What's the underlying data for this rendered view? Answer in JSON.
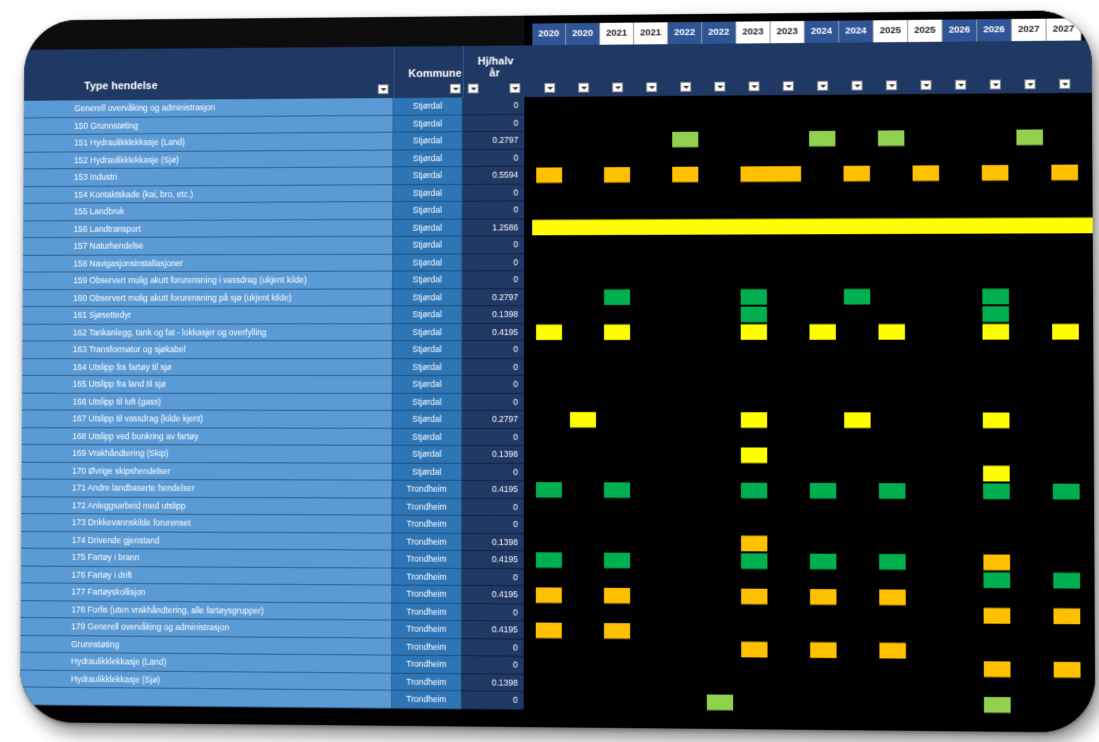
{
  "headers": {
    "type_hendelse": "Type hendelse",
    "kommune": "Kommune",
    "frequency": "Hj/halv år"
  },
  "years": [
    "2020",
    "2020",
    "2021",
    "2021",
    "2022",
    "2022",
    "2023",
    "2023",
    "2024",
    "2024",
    "2025",
    "2025",
    "2026",
    "2026",
    "2027",
    "2027"
  ],
  "year_style": [
    "b",
    "b",
    "w",
    "w",
    "b",
    "b",
    "w",
    "w",
    "b",
    "b",
    "w",
    "w",
    "b",
    "b",
    "w",
    "w"
  ],
  "rows": [
    {
      "label": "Generell overvåking og administrasjon",
      "kommune": "Stjørdal",
      "value": "0"
    },
    {
      "label": "150 Grunnstøting",
      "kommune": "Stjørdal",
      "value": "0"
    },
    {
      "label": "151 Hydraulikklekkasje (Land)",
      "kommune": "Stjørdal",
      "value": "0.2797"
    },
    {
      "label": "152 Hydraulikklekkasje (Sjø)",
      "kommune": "Stjørdal",
      "value": "0"
    },
    {
      "label": "153 Industri",
      "kommune": "Stjørdal",
      "value": "0.5594"
    },
    {
      "label": "154 Kontaktskade (kai, bro, etc.)",
      "kommune": "Stjørdal",
      "value": "0"
    },
    {
      "label": "155 Landbruk",
      "kommune": "Stjørdal",
      "value": "0"
    },
    {
      "label": "156 Landtransport",
      "kommune": "Stjørdal",
      "value": "1.2586"
    },
    {
      "label": "157 Naturhendelse",
      "kommune": "Stjørdal",
      "value": "0"
    },
    {
      "label": "158 Navigasjonsinstallasjoner",
      "kommune": "Stjørdal",
      "value": "0"
    },
    {
      "label": "159 Observert mulig akutt forurensning i vassdrag (ukjent kilde)",
      "kommune": "Stjørdal",
      "value": "0"
    },
    {
      "label": "160 Observert mulig akutt forurensning på sjø (ukjent kilde)",
      "kommune": "Stjørdal",
      "value": "0.2797"
    },
    {
      "label": "161 Sjøsettedyr",
      "kommune": "Stjørdal",
      "value": "0.1398"
    },
    {
      "label": "162 Tankanlegg, tank og fat - lokkasjer og overfylling",
      "kommune": "Stjørdal",
      "value": "0.4195"
    },
    {
      "label": "163 Transformator og sjøkabel",
      "kommune": "Stjørdal",
      "value": "0"
    },
    {
      "label": "164 Utslipp fra fartøy til sjø",
      "kommune": "Stjørdal",
      "value": "0"
    },
    {
      "label": "165 Utslipp fra land til sjø",
      "kommune": "Stjørdal",
      "value": "0"
    },
    {
      "label": "166 Utslipp til luft (gass)",
      "kommune": "Stjørdal",
      "value": "0"
    },
    {
      "label": "167 Utslipp til vassdrag (kilde kjent)",
      "kommune": "Stjørdal",
      "value": "0.2797"
    },
    {
      "label": "168 Utslipp ved bunkring av fartøy",
      "kommune": "Stjørdal",
      "value": "0"
    },
    {
      "label": "169 Vrakhåndtering (Skip)",
      "kommune": "Stjørdal",
      "value": "0.1398"
    },
    {
      "label": "170 Øvrige skipshendelser",
      "kommune": "Stjørdal",
      "value": "0"
    },
    {
      "label": "171 Andre landbaserte hendelser",
      "kommune": "Trondheim",
      "value": "0.4195"
    },
    {
      "label": "172 Anleggsarbeid med utslipp",
      "kommune": "Trondheim",
      "value": "0"
    },
    {
      "label": "173 Drikkevannskilde forurenset",
      "kommune": "Trondheim",
      "value": "0"
    },
    {
      "label": "174 Drivende gjenstand",
      "kommune": "Trondheim",
      "value": "0.1398"
    },
    {
      "label": "175 Fartøy i brann",
      "kommune": "Trondheim",
      "value": "0.4195"
    },
    {
      "label": "176 Fartøy i drift",
      "kommune": "Trondheim",
      "value": "0"
    },
    {
      "label": "177 Fartøyskollisjon",
      "kommune": "Trondheim",
      "value": "0.4195"
    },
    {
      "label": "178 Forlis (uten vrakhåndtering, alle fartøysgrupper)",
      "kommune": "Trondheim",
      "value": "0"
    },
    {
      "label": "179 Generell overvåking og administrasjon",
      "kommune": "Trondheim",
      "value": "0.4195"
    },
    {
      "label": "Grunnstøting",
      "kommune": "Trondheim",
      "value": "0"
    },
    {
      "label": "Hydraulikklekkasje (Land)",
      "kommune": "Trondheim",
      "value": "0"
    },
    {
      "label": "Hydraulikklekkasje (Sjø)",
      "kommune": "Trondheim",
      "value": "0.1398"
    },
    {
      "label": "",
      "kommune": "Trondheim",
      "value": "0"
    }
  ],
  "colors": {
    "light_green": "#92d050",
    "green": "#00b050",
    "orange": "#ffc000",
    "yellow": "#ffff00",
    "header_dark": "#1f3864",
    "row_blue": "#5b9bd5"
  },
  "grid_marks": [
    {
      "row": 2,
      "from": 4,
      "to": 4,
      "color": "light_green"
    },
    {
      "row": 2,
      "from": 8,
      "to": 8,
      "color": "light_green"
    },
    {
      "row": 2,
      "from": 10,
      "to": 10,
      "color": "light_green"
    },
    {
      "row": 2,
      "from": 14,
      "to": 14,
      "color": "light_green"
    },
    {
      "row": 4,
      "from": 0,
      "to": 0,
      "color": "orange"
    },
    {
      "row": 4,
      "from": 2,
      "to": 2,
      "color": "orange"
    },
    {
      "row": 4,
      "from": 4,
      "to": 4,
      "color": "orange"
    },
    {
      "row": 4,
      "from": 6,
      "to": 7,
      "color": "orange"
    },
    {
      "row": 4,
      "from": 9,
      "to": 9,
      "color": "orange"
    },
    {
      "row": 4,
      "from": 11,
      "to": 11,
      "color": "orange"
    },
    {
      "row": 4,
      "from": 13,
      "to": 13,
      "color": "orange"
    },
    {
      "row": 4,
      "from": 15,
      "to": 15,
      "color": "orange"
    },
    {
      "row": 7,
      "from": 0,
      "to": 15,
      "color": "yellow"
    },
    {
      "row": 11,
      "from": 2,
      "to": 2,
      "color": "green"
    },
    {
      "row": 11,
      "from": 6,
      "to": 6,
      "color": "green"
    },
    {
      "row": 12,
      "from": 6,
      "to": 6,
      "color": "green"
    },
    {
      "row": 11,
      "from": 9,
      "to": 9,
      "color": "green"
    },
    {
      "row": 11,
      "from": 13,
      "to": 13,
      "color": "green"
    },
    {
      "row": 12,
      "from": 13,
      "to": 13,
      "color": "green"
    },
    {
      "row": 13,
      "from": 0,
      "to": 0,
      "color": "yellow"
    },
    {
      "row": 13,
      "from": 2,
      "to": 2,
      "color": "yellow"
    },
    {
      "row": 13,
      "from": 6,
      "to": 6,
      "color": "yellow"
    },
    {
      "row": 13,
      "from": 8,
      "to": 8,
      "color": "yellow"
    },
    {
      "row": 13,
      "from": 10,
      "to": 10,
      "color": "yellow"
    },
    {
      "row": 13,
      "from": 13,
      "to": 13,
      "color": "yellow"
    },
    {
      "row": 13,
      "from": 15,
      "to": 15,
      "color": "yellow"
    },
    {
      "row": 18,
      "from": 1,
      "to": 1,
      "color": "yellow"
    },
    {
      "row": 18,
      "from": 6,
      "to": 6,
      "color": "yellow"
    },
    {
      "row": 18,
      "from": 9,
      "to": 9,
      "color": "yellow"
    },
    {
      "row": 18,
      "from": 13,
      "to": 13,
      "color": "yellow"
    },
    {
      "row": 20,
      "from": 6,
      "to": 6,
      "color": "yellow"
    },
    {
      "row": 21,
      "from": 13,
      "to": 13,
      "color": "yellow"
    },
    {
      "row": 22,
      "from": 0,
      "to": 0,
      "color": "green"
    },
    {
      "row": 22,
      "from": 2,
      "to": 2,
      "color": "green"
    },
    {
      "row": 22,
      "from": 6,
      "to": 6,
      "color": "green"
    },
    {
      "row": 22,
      "from": 8,
      "to": 8,
      "color": "green"
    },
    {
      "row": 22,
      "from": 10,
      "to": 10,
      "color": "green"
    },
    {
      "row": 22,
      "from": 13,
      "to": 13,
      "color": "green"
    },
    {
      "row": 22,
      "from": 15,
      "to": 15,
      "color": "green"
    },
    {
      "row": 25,
      "from": 6,
      "to": 6,
      "color": "orange"
    },
    {
      "row": 26,
      "from": 0,
      "to": 0,
      "color": "green"
    },
    {
      "row": 26,
      "from": 2,
      "to": 2,
      "color": "green"
    },
    {
      "row": 26,
      "from": 6,
      "to": 6,
      "color": "green"
    },
    {
      "row": 26,
      "from": 8,
      "to": 8,
      "color": "green"
    },
    {
      "row": 26,
      "from": 10,
      "to": 10,
      "color": "green"
    },
    {
      "row": 26,
      "from": 13,
      "to": 13,
      "color": "orange"
    },
    {
      "row": 27,
      "from": 13,
      "to": 13,
      "color": "green"
    },
    {
      "row": 27,
      "from": 15,
      "to": 15,
      "color": "green"
    },
    {
      "row": 28,
      "from": 0,
      "to": 0,
      "color": "orange"
    },
    {
      "row": 28,
      "from": 2,
      "to": 2,
      "color": "orange"
    },
    {
      "row": 28,
      "from": 6,
      "to": 6,
      "color": "orange"
    },
    {
      "row": 28,
      "from": 8,
      "to": 8,
      "color": "orange"
    },
    {
      "row": 28,
      "from": 10,
      "to": 10,
      "color": "orange"
    },
    {
      "row": 29,
      "from": 13,
      "to": 13,
      "color": "orange"
    },
    {
      "row": 29,
      "from": 15,
      "to": 15,
      "color": "orange"
    },
    {
      "row": 30,
      "from": 0,
      "to": 0,
      "color": "orange"
    },
    {
      "row": 30,
      "from": 2,
      "to": 2,
      "color": "orange"
    },
    {
      "row": 31,
      "from": 6,
      "to": 6,
      "color": "orange"
    },
    {
      "row": 31,
      "from": 8,
      "to": 8,
      "color": "orange"
    },
    {
      "row": 31,
      "from": 10,
      "to": 10,
      "color": "orange"
    },
    {
      "row": 32,
      "from": 13,
      "to": 13,
      "color": "orange"
    },
    {
      "row": 32,
      "from": 15,
      "to": 15,
      "color": "orange"
    },
    {
      "row": 34,
      "from": 5,
      "to": 5,
      "color": "light_green"
    },
    {
      "row": 34,
      "from": 13,
      "to": 13,
      "color": "light_green"
    }
  ]
}
